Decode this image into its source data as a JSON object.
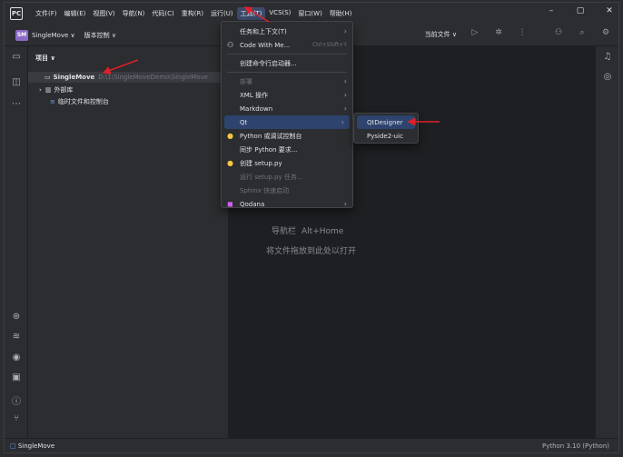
{
  "menubar": {
    "logo": "PC",
    "items": [
      "文件(F)",
      "编辑(E)",
      "视图(V)",
      "导航(N)",
      "代码(C)",
      "重构(R)",
      "运行(U)",
      "工具(T)",
      "VCS(S)",
      "窗口(W)",
      "帮助(H)"
    ],
    "minimize": "–",
    "maximize": "▢",
    "close": "✕"
  },
  "toolbar": {
    "project_badge": "SM",
    "project_name": "SingleMove ∨",
    "vcs_label": "版本控制 ∨",
    "run_config": "当前文件 ∨"
  },
  "project_panel": {
    "title": "项目 ∨",
    "root_name": "SingleMove",
    "root_path": "D:\\1\\SingleMoveDemo\\SingleMove",
    "external_libs": "外部库",
    "scratches": "临时文件和控制台"
  },
  "editor": {
    "nav_hint": "导航栏",
    "nav_shortcut": "Alt+Home",
    "drop_hint": "将文件拖放到此处以打开"
  },
  "tools_menu": {
    "items": [
      {
        "label": "任务和上下文(T)",
        "submenu": true
      },
      {
        "label": "Code With Me...",
        "shortcut": "Ctrl+Shift+Y",
        "icon": "code-with-me-icon"
      },
      {
        "label": "创建命令行启动器..."
      },
      {
        "label": "部署",
        "submenu": true,
        "disabled": true
      },
      {
        "label": "XML 操作",
        "submenu": true
      },
      {
        "label": "Markdown",
        "submenu": true
      },
      {
        "label": "Qt",
        "submenu": true,
        "highlight": true
      },
      {
        "label": "Python 或调试控制台",
        "icon": "python-icon"
      },
      {
        "label": "同步 Python 要求..."
      },
      {
        "label": "创建 setup.py",
        "icon": "python-icon"
      },
      {
        "label": "运行 setup.py 任务...",
        "disabled": true
      },
      {
        "label": "Sphinx 快速启动",
        "disabled": true
      },
      {
        "label": "Qodana",
        "submenu": true,
        "icon": "qodana-icon"
      }
    ]
  },
  "qt_submenu": {
    "items": [
      "QtDesigner",
      "Pyside2-uic"
    ]
  },
  "statusbar": {
    "left": "SingleMove",
    "right": "Python 3.10 (Python)"
  },
  "colors": {
    "accent_arrow": "#e0202a",
    "highlight": "#2e436e"
  }
}
